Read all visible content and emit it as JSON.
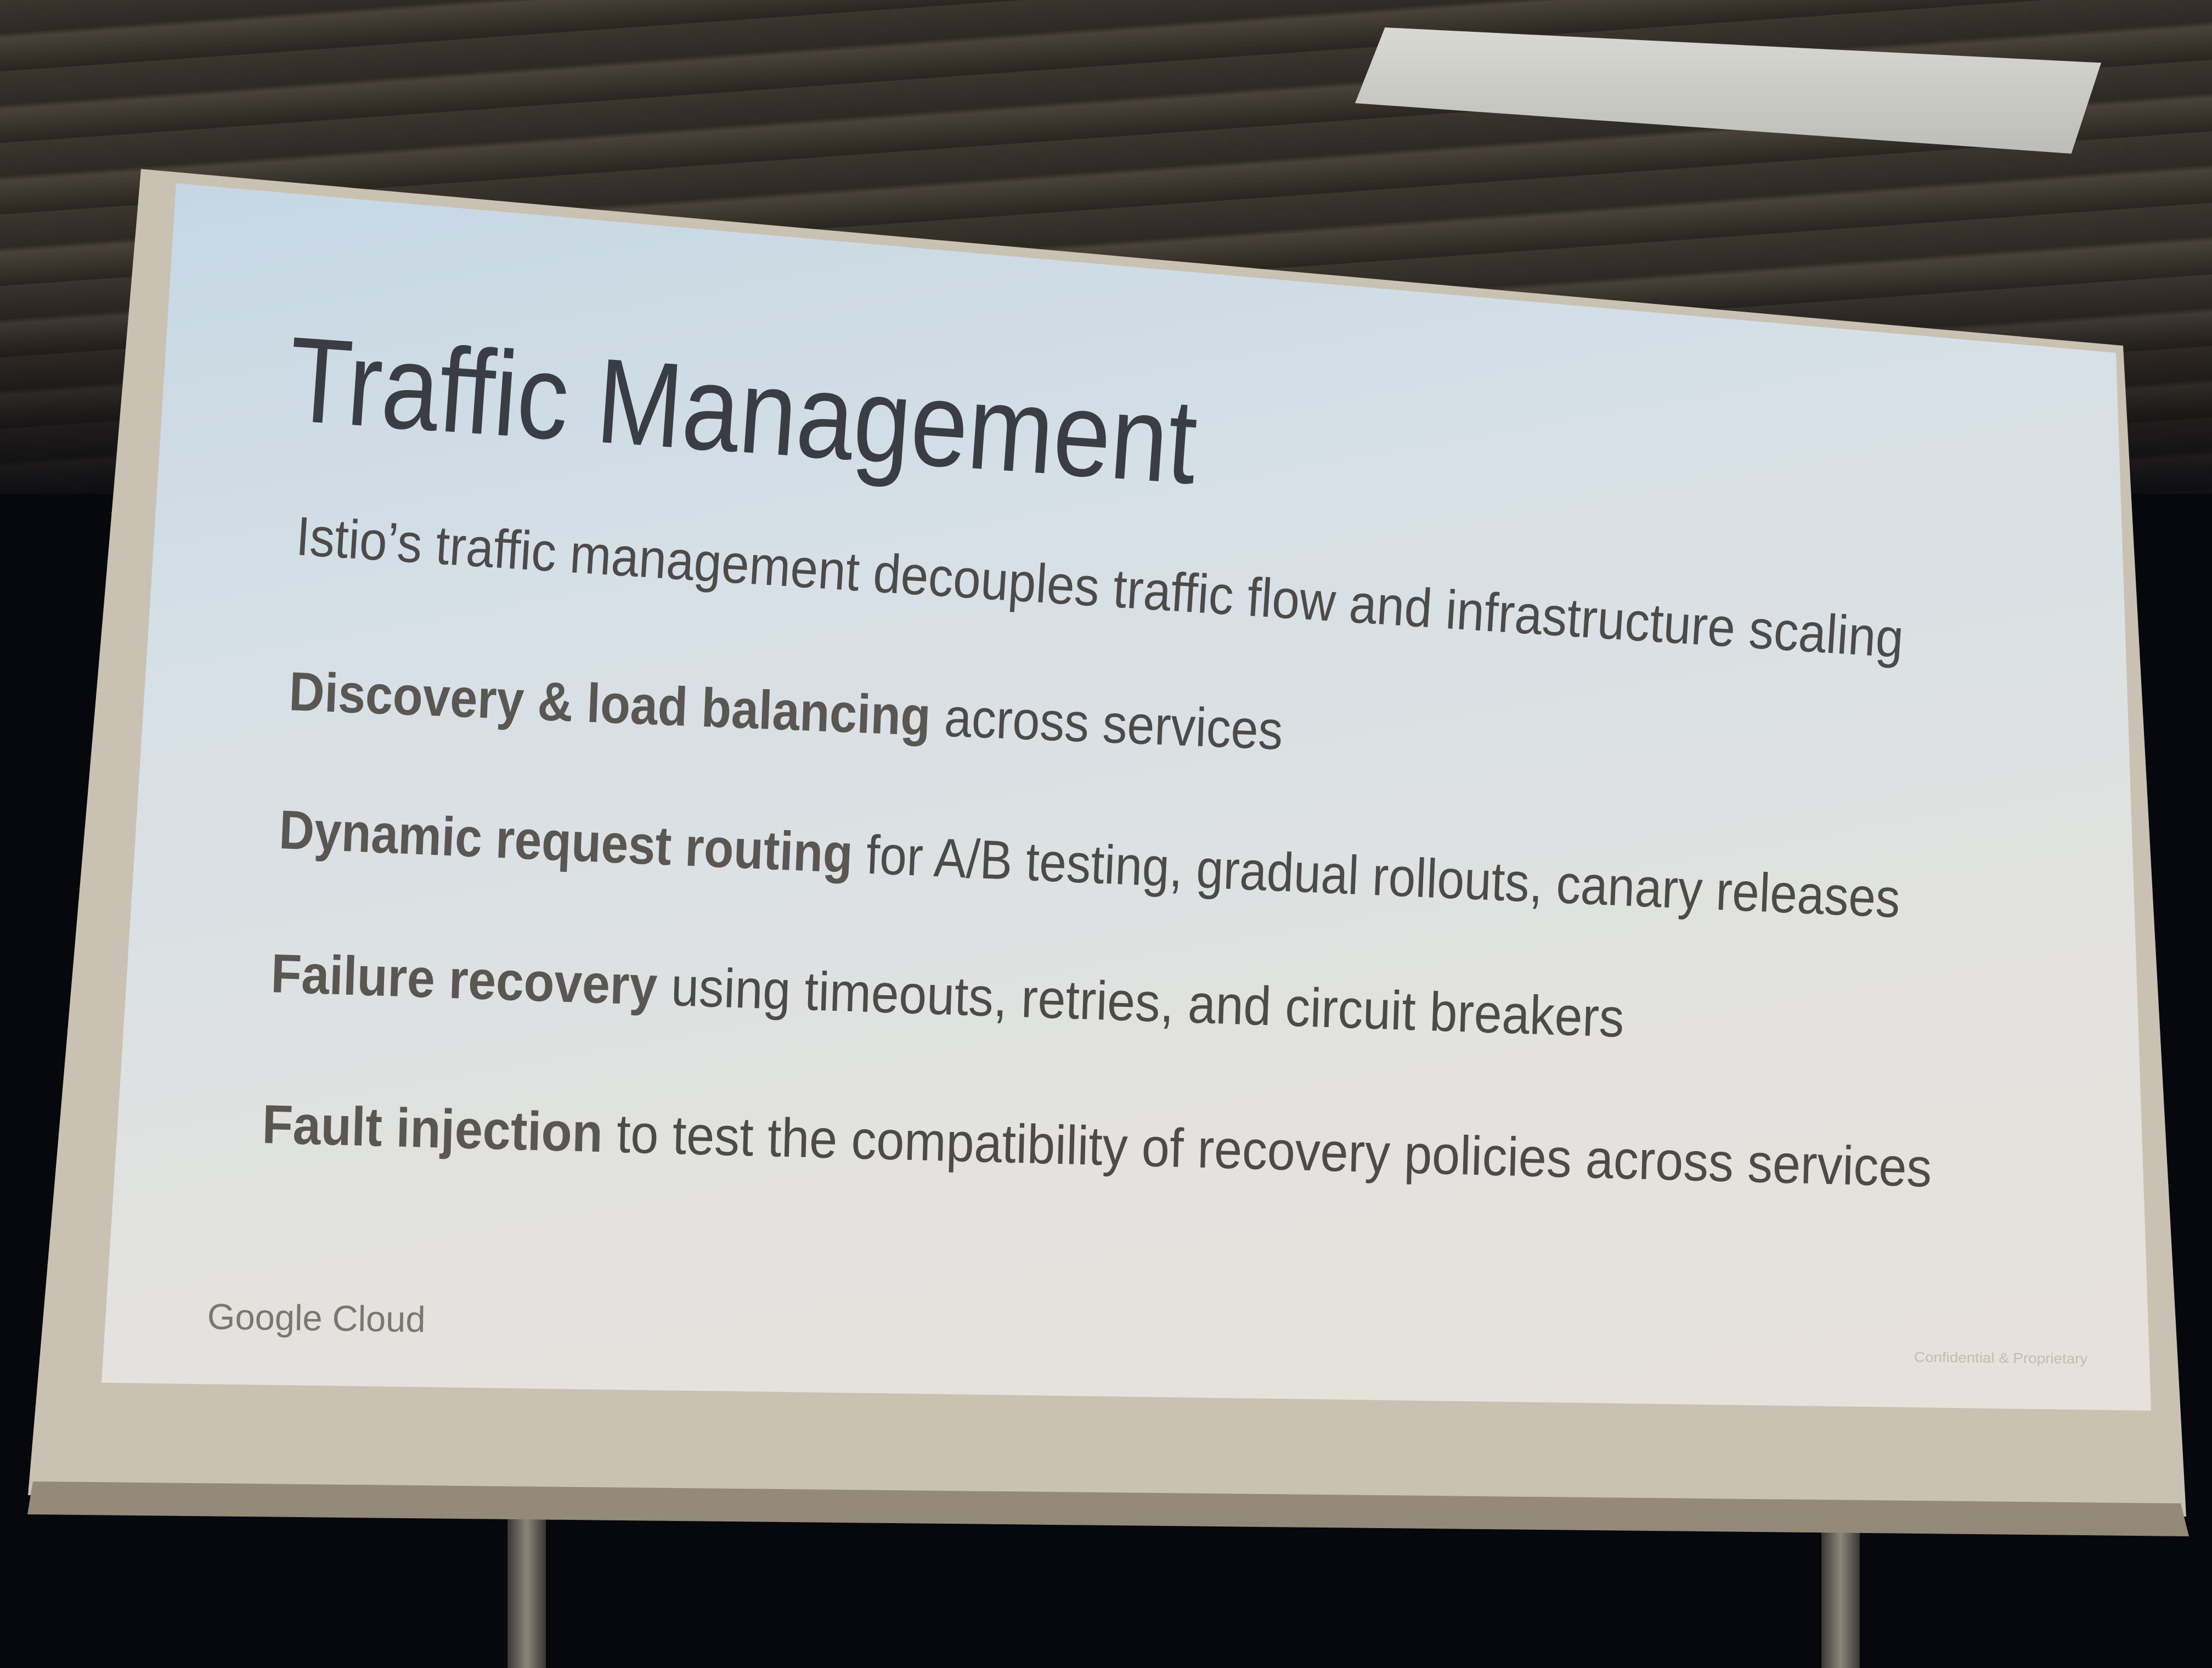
{
  "slide": {
    "title": "Traffic Management",
    "lines": [
      {
        "bold": "",
        "text": "Istio’s traffic management decouples traffic flow and infrastructure scaling"
      },
      {
        "bold": "Discovery & load balancing",
        "text": " across services"
      },
      {
        "bold": "Dynamic request routing",
        "text": " for A/B testing, gradual rollouts, canary releases"
      },
      {
        "bold": "Failure recovery",
        "text": " using timeouts, retries, and circuit breakers"
      },
      {
        "bold": "Fault injection",
        "text": " to test the compatibility of recovery policies across services"
      }
    ],
    "logo": "Google Cloud",
    "footer": "Confidential & Proprietary"
  }
}
